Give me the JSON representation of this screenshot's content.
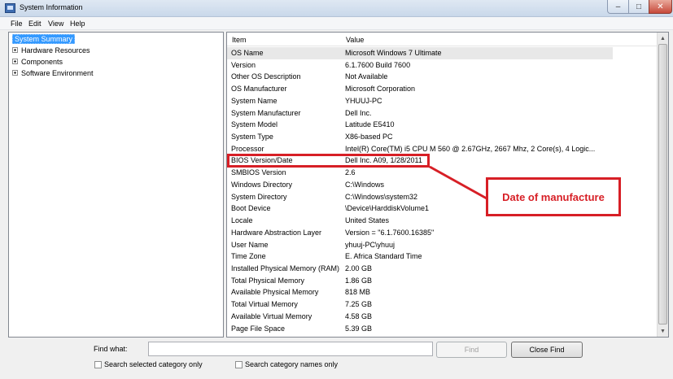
{
  "window": {
    "title": "System Information"
  },
  "window_controls": {
    "minimize": "–",
    "maximize": "□",
    "close": "✕"
  },
  "menu": [
    "File",
    "Edit",
    "View",
    "Help"
  ],
  "tree": {
    "selected": "System Summary",
    "nodes": [
      "Hardware Resources",
      "Components",
      "Software Environment"
    ]
  },
  "table": {
    "headers": {
      "item": "Item",
      "value": "Value"
    },
    "rows": [
      {
        "item": "OS Name",
        "value": "Microsoft Windows 7 Ultimate"
      },
      {
        "item": "Version",
        "value": "6.1.7600 Build 7600"
      },
      {
        "item": "Other OS Description",
        "value": "Not Available"
      },
      {
        "item": "OS Manufacturer",
        "value": "Microsoft Corporation"
      },
      {
        "item": "System Name",
        "value": "YHUUJ-PC"
      },
      {
        "item": "System Manufacturer",
        "value": "Dell Inc."
      },
      {
        "item": "System Model",
        "value": "Latitude E5410"
      },
      {
        "item": "System Type",
        "value": "X86-based PC"
      },
      {
        "item": "Processor",
        "value": "Intel(R) Core(TM) i5 CPU       M 560  @ 2.67GHz, 2667 Mhz, 2 Core(s), 4 Logic..."
      },
      {
        "item": "BIOS Version/Date",
        "value": "Dell Inc. A09, 1/28/2011"
      },
      {
        "item": "SMBIOS Version",
        "value": "2.6"
      },
      {
        "item": "Windows Directory",
        "value": "C:\\Windows"
      },
      {
        "item": "System Directory",
        "value": "C:\\Windows\\system32"
      },
      {
        "item": "Boot Device",
        "value": "\\Device\\HarddiskVolume1"
      },
      {
        "item": "Locale",
        "value": "United States"
      },
      {
        "item": "Hardware Abstraction Layer",
        "value": "Version = \"6.1.7600.16385\""
      },
      {
        "item": "User Name",
        "value": "yhuuj-PC\\yhuuj"
      },
      {
        "item": "Time Zone",
        "value": "E. Africa Standard Time"
      },
      {
        "item": "Installed Physical Memory (RAM)",
        "value": "2.00 GB"
      },
      {
        "item": "Total Physical Memory",
        "value": "1.86 GB"
      },
      {
        "item": "Available Physical Memory",
        "value": "818 MB"
      },
      {
        "item": "Total Virtual Memory",
        "value": "7.25 GB"
      },
      {
        "item": "Available Virtual Memory",
        "value": "4.58 GB"
      },
      {
        "item": "Page File Space",
        "value": "5.39 GB"
      }
    ]
  },
  "annotation": {
    "label": "Date of manufacture",
    "color": "#d71f26"
  },
  "find": {
    "label": "Find what:",
    "input_value": "",
    "find_button": "Find",
    "close_button": "Close Find",
    "search_selected": "Search selected category only",
    "search_names": "Search category names only"
  },
  "colors": {
    "selection": "#3399ff",
    "row_highlight": "#e8e8e8"
  }
}
